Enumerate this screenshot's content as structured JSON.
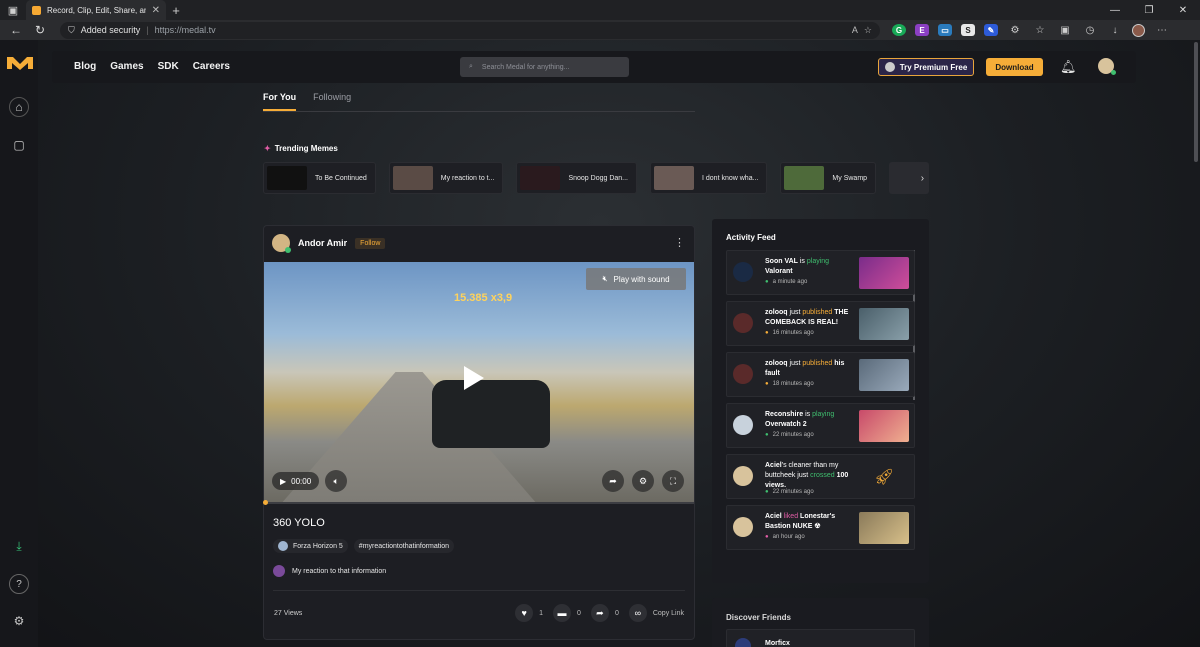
{
  "browser": {
    "tab_title": "Record, Clip, Edit, Share, and Rel",
    "security_label": "Added security",
    "separator": "|",
    "url": "https://medal.tv"
  },
  "nav": {
    "links": [
      "Blog",
      "Games",
      "SDK",
      "Careers"
    ],
    "search_placeholder": "Search Medal for anything...",
    "premium_label": "Try Premium Free",
    "download_label": "Download"
  },
  "feed_tabs": [
    "For You",
    "Following"
  ],
  "trending": {
    "title": "Trending Memes",
    "items": [
      {
        "label": "To Be Continued"
      },
      {
        "label": "My reaction to t..."
      },
      {
        "label": "Snoop Dogg Dan..."
      },
      {
        "label": "I dont know wha..."
      },
      {
        "label": "My Swamp"
      }
    ]
  },
  "post": {
    "author": "Andor Amir",
    "follow_label": "Follow",
    "play_with_sound": "Play with sound",
    "time": "00:00",
    "score_text": "15.385 x3,9",
    "title": "360 YOLO",
    "tags": [
      "Forza Horizon 5",
      "#myreactiontothatinformation"
    ],
    "sound": "My reaction to that information",
    "views": "27 Views",
    "likes": "1",
    "comments": "0",
    "shares": "0",
    "copy_link": "Copy Link"
  },
  "activity_feed": {
    "title": "Activity Feed",
    "items": [
      {
        "text_a": "Soon VAL",
        "verb": " is ",
        "action": "playing",
        "text_b": " Valorant",
        "time": "a minute ago",
        "accent": "#3fbf6f"
      },
      {
        "text_a": "zolooq",
        "verb": " just ",
        "action": "published",
        "text_b": " THE COMEBACK IS REAL!",
        "time": "16 minutes ago",
        "accent": "#f6ad38"
      },
      {
        "text_a": "zolooq",
        "verb": " just ",
        "action": "published",
        "text_b": " his fault",
        "time": "18 minutes ago",
        "accent": "#f6ad38"
      },
      {
        "text_a": "Reconshire",
        "verb": " is ",
        "action": "playing",
        "text_b": " Overwatch 2",
        "time": "22 minutes ago",
        "accent": "#3fbf6f"
      },
      {
        "text_a": "Aciel",
        "verb": "'s cleaner than my buttcheek just ",
        "action": "crossed",
        "text_b": " 100 views.",
        "time": "22 minutes ago",
        "accent": "#3fbf6f"
      },
      {
        "text_a": "Aciel",
        "verb": " ",
        "action": "liked",
        "text_b": " Lonestar's Bastion NUKE ☢",
        "time": "an hour ago",
        "accent": "#e15da6"
      }
    ]
  },
  "discover": {
    "title": "Discover Friends",
    "first_name": "Morficx"
  },
  "colors": {
    "accent": "#f6ad38",
    "premium_bg": "#2b2548",
    "online": "#3fbf6f"
  }
}
